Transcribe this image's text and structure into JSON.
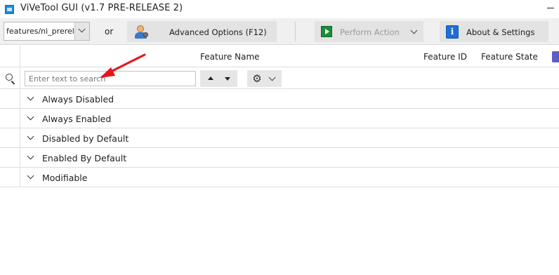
{
  "window": {
    "title": "ViVeTool GUI (v1.7 PRE-RELEASE 2)"
  },
  "toolbar": {
    "branch_value": "features/ni_prerelease",
    "or_label": "or",
    "advanced_label": "Advanced Options (F12)",
    "perform_label": "Perform Action",
    "about_label": "About & Settings"
  },
  "grid": {
    "columns": [
      "Feature Name",
      "Feature ID",
      "Feature State"
    ],
    "search_placeholder": "Enter text to search",
    "groups": [
      "Always Disabled",
      "Always Enabled",
      "Disabled by Default",
      "Enabled By Default",
      "Modifiable"
    ]
  },
  "colors": {
    "accent_blue": "#1d6fd6",
    "play_green": "#1c8b3a",
    "annotation_red": "#e8141b",
    "disabled_text": "#9a9a9a"
  },
  "icons": {
    "app": "app-icon",
    "advanced": "user-settings-icon",
    "perform": "play-icon",
    "about": "info-icon",
    "search": "search-icon",
    "settings": "gear-icon"
  }
}
